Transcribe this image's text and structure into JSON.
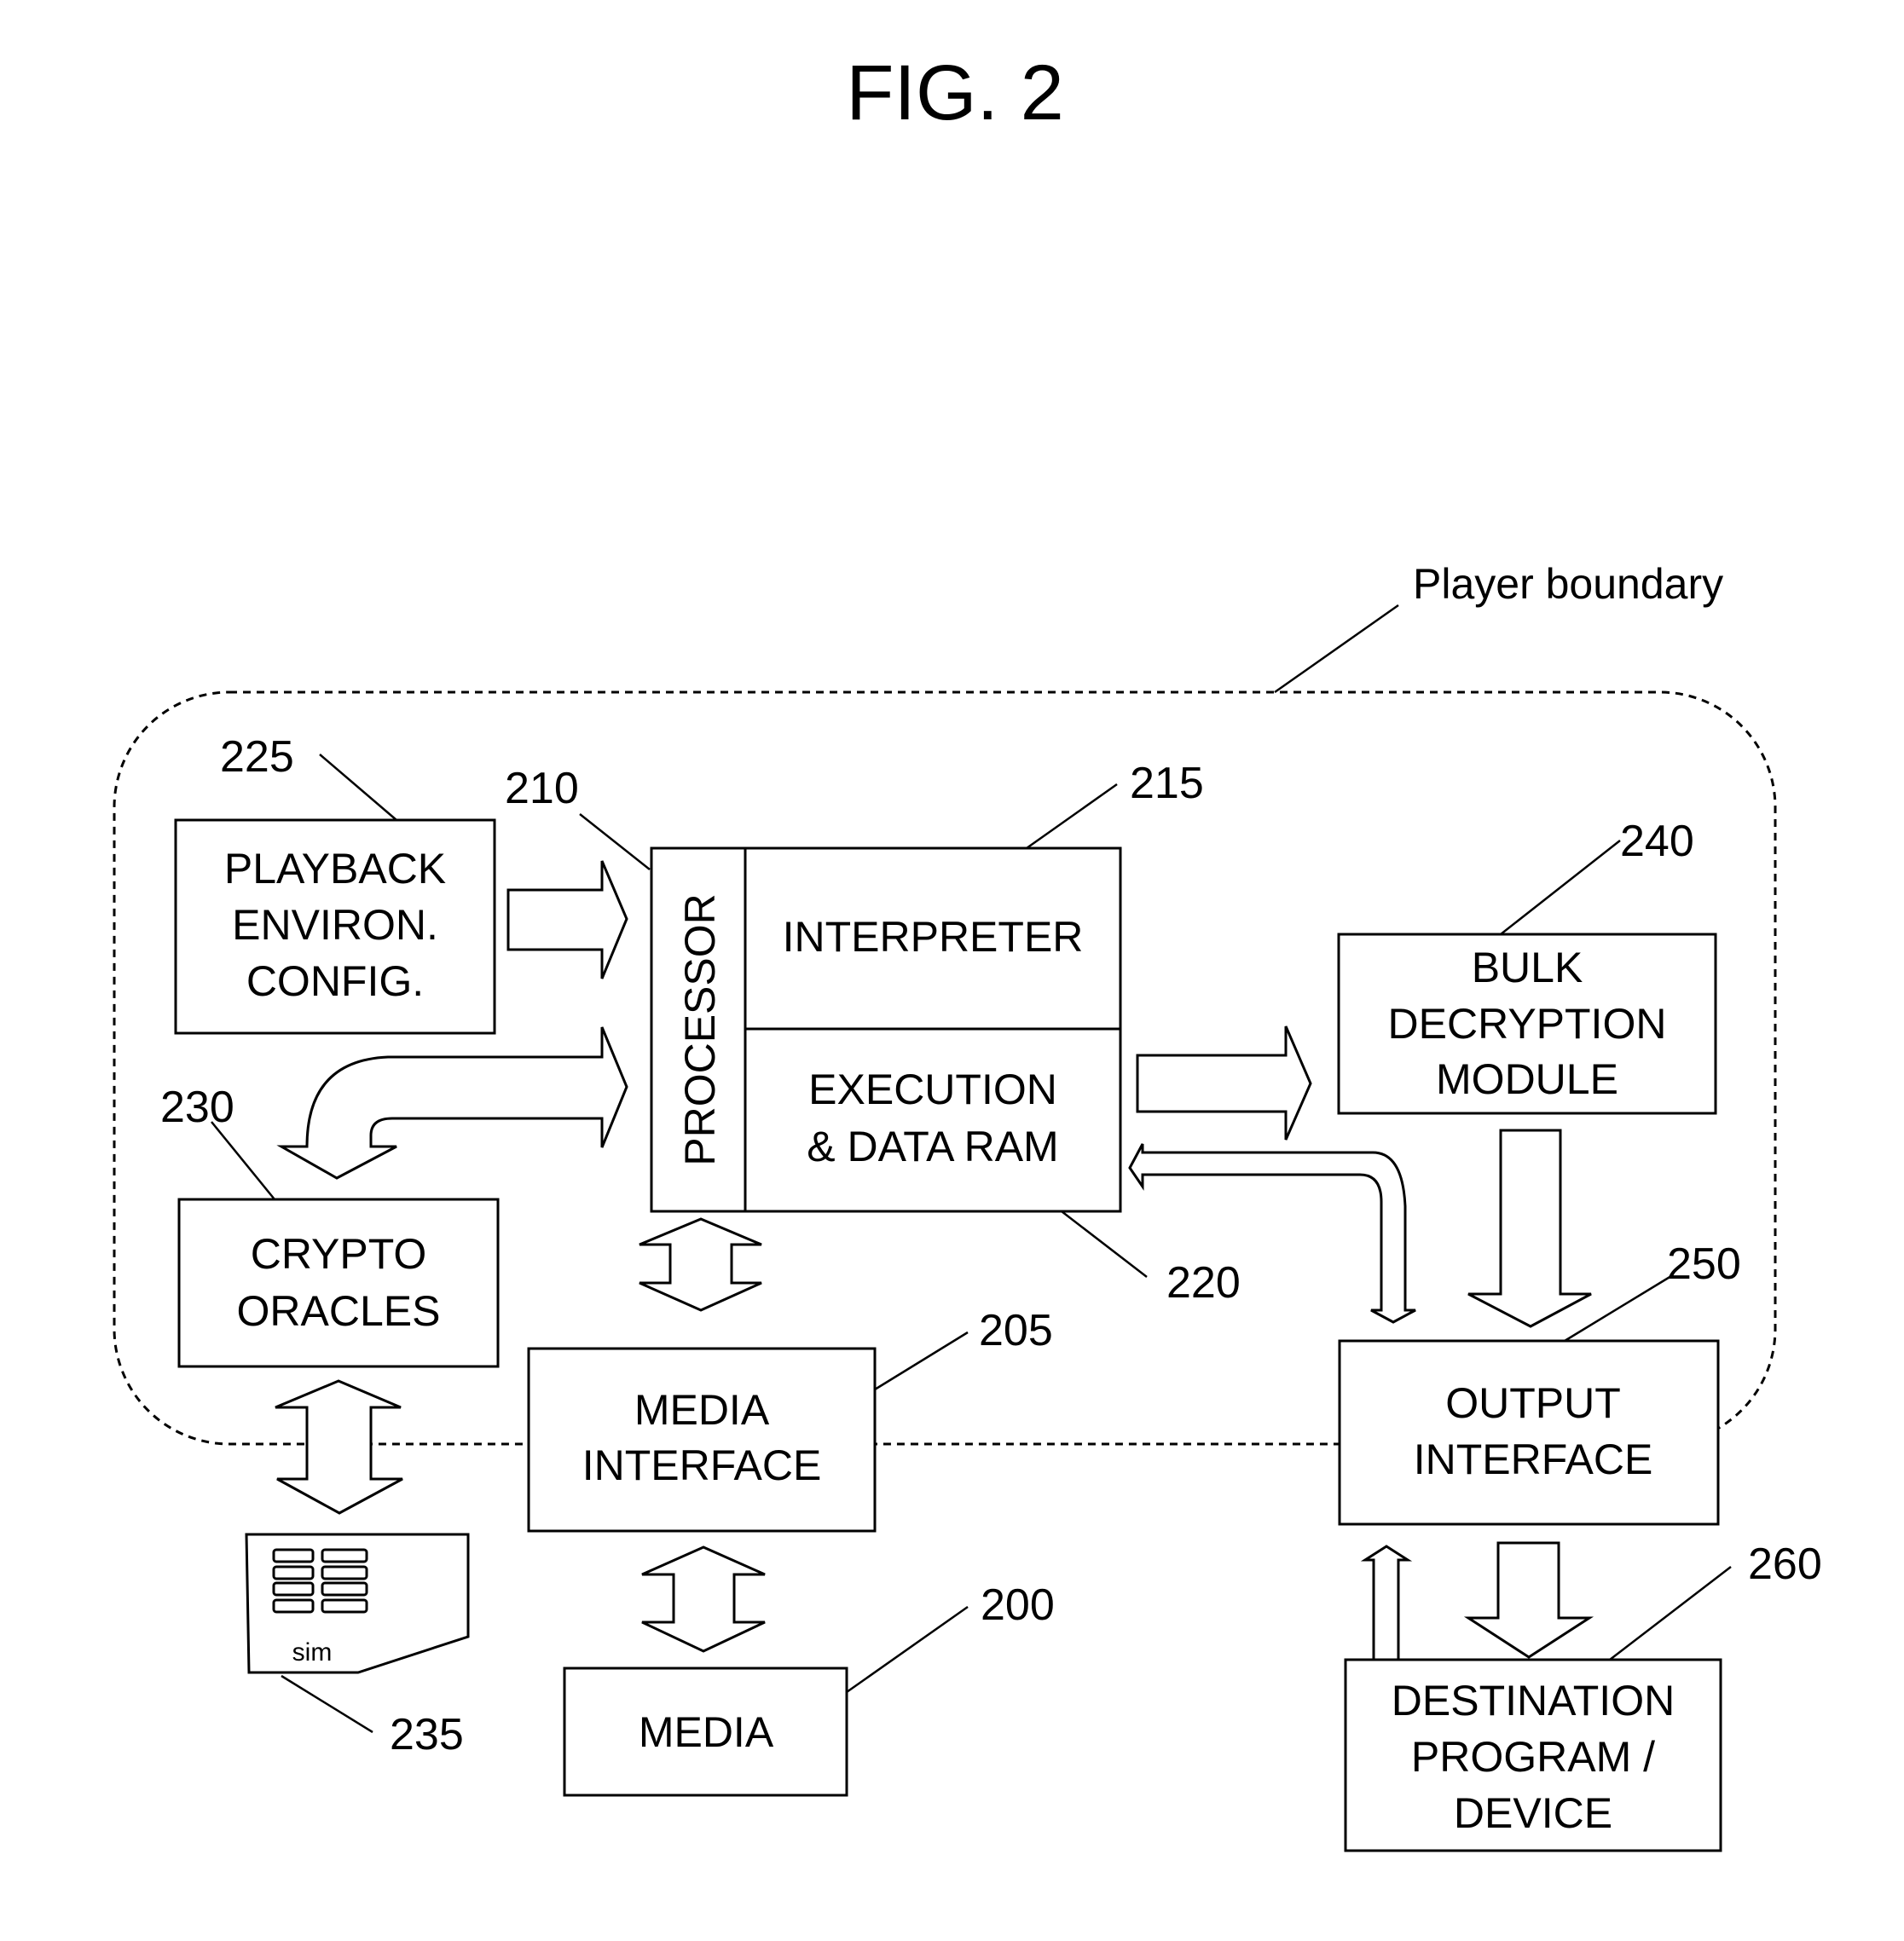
{
  "figure": {
    "title": "FIG. 2",
    "boundary_label": "Player boundary"
  },
  "blocks": {
    "playback": {
      "ref": "225",
      "lines": [
        "PLAYBACK",
        "ENVIRON.",
        "CONFIG."
      ]
    },
    "processor": {
      "ref": "210",
      "label": "PROCESSOR"
    },
    "interpreter": {
      "ref": "215",
      "label": "INTERPRETER"
    },
    "ram": {
      "ref": "220",
      "lines": [
        "EXECUTION",
        "& DATA RAM"
      ]
    },
    "bulk": {
      "ref": "240",
      "lines": [
        "BULK",
        "DECRYPTION",
        "MODULE"
      ]
    },
    "crypto": {
      "ref": "230",
      "lines": [
        "CRYPTO",
        "ORACLES"
      ]
    },
    "media_interface": {
      "ref": "205",
      "lines": [
        "MEDIA",
        "INTERFACE"
      ]
    },
    "media": {
      "ref": "200",
      "label": "MEDIA"
    },
    "output": {
      "ref": "250",
      "lines": [
        "OUTPUT",
        "INTERFACE"
      ]
    },
    "destination": {
      "ref": "260",
      "lines": [
        "DESTINATION",
        "PROGRAM /",
        "DEVICE"
      ]
    },
    "sim": {
      "ref": "235",
      "label": "sim"
    }
  }
}
